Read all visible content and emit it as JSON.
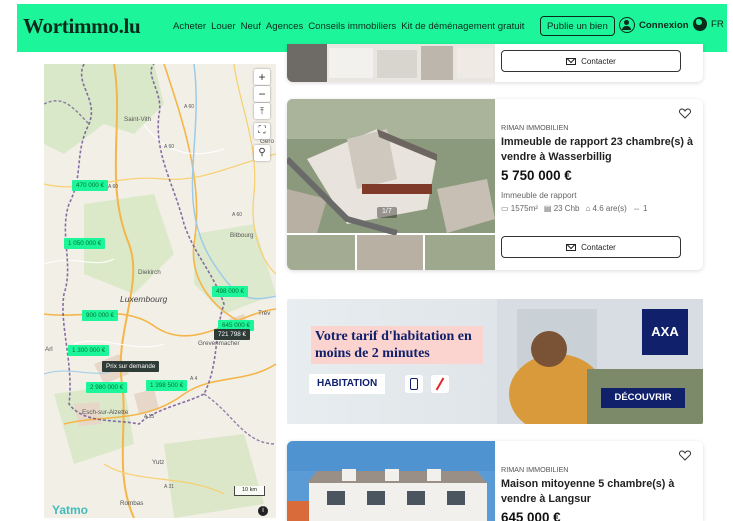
{
  "header": {
    "logo": "Wortimmo.lu",
    "nav": [
      "Acheter",
      "Louer",
      "Neuf",
      "Agences",
      "Conseils immobiliers",
      "Kit de déménagement gratuit"
    ],
    "publish_label": "Publie un bien",
    "login_label": "Connexion",
    "lang_label": "FR",
    "accent": "#1df59a"
  },
  "map": {
    "controls": [
      "+",
      "−",
      "⤒",
      "⛶",
      "⚲"
    ],
    "places": [
      "Saint-Vith",
      "Bitbourg",
      "Diekirch",
      "Luxembourg",
      "Trèv",
      "Grevenmacher",
      "Esch-sur-Alzette",
      "Yutz",
      "Rombas",
      "Arl",
      "Gero"
    ],
    "price_tags": [
      "470 000 €",
      "1 050 000 €",
      "498 000 €",
      "900 000 €",
      "721 798 €",
      "645 000 €",
      "1 300 000 €",
      "Prix sur demande",
      "2 980 000 €",
      "1 398 500 €"
    ],
    "road_labels": [
      "A 60",
      "A 60",
      "A 60",
      "A 60",
      "A 1",
      "A 13",
      "A 31",
      "A 4"
    ],
    "scale_label": "10 km",
    "brand": "Yatmo"
  },
  "listings": [
    {
      "contact_label": "Contacter"
    },
    {
      "agency": "RIMAN IMMOBILIEN",
      "title": "Immeuble de rapport 23 chambre(s) à vendre à Wasserbillig",
      "price": "5 750 000 €",
      "type": "Immeuble de rapport",
      "specs": [
        "1575m²",
        "23 Chb",
        "4.6 are(s)",
        "1"
      ],
      "photo_counter": "1/7",
      "contact_label": "Contacter"
    },
    {
      "agency": "RIMAN IMMOBILIEN",
      "title": "Maison mitoyenne 5 chambre(s) à vendre à Langsur",
      "price": "645 000 €"
    }
  ],
  "ad": {
    "title": "Votre tarif d'habitation en moins de 2 minutes",
    "chip": "HABITATION",
    "cta": "DÉCOUVRIR",
    "brand": "AXA"
  }
}
